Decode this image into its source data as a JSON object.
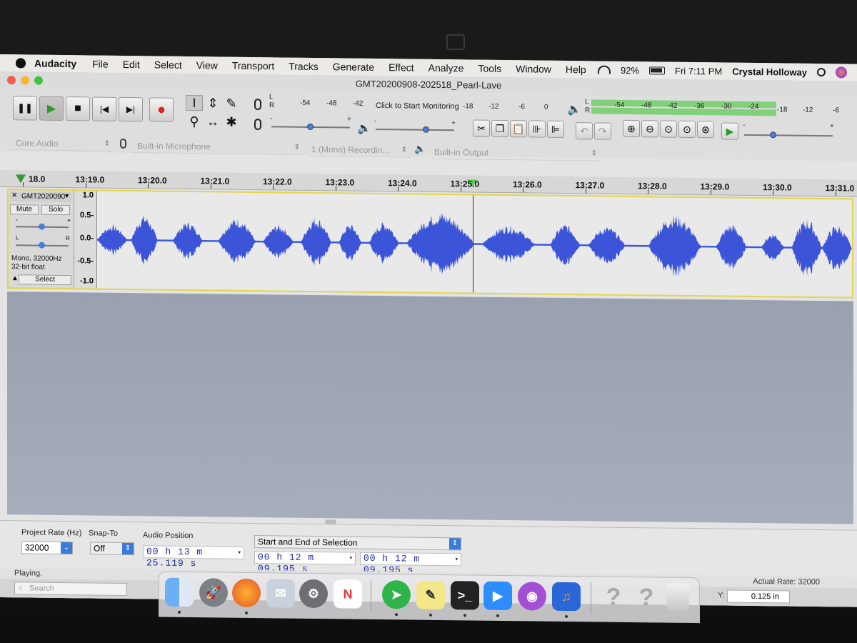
{
  "menubar": {
    "app_name": "Audacity",
    "items": [
      "File",
      "Edit",
      "Select",
      "View",
      "Transport",
      "Tracks",
      "Generate",
      "Effect",
      "Analyze",
      "Tools",
      "Window",
      "Help"
    ],
    "battery": "92%",
    "clock": "Fri 7:11 PM",
    "user": "Crystal Holloway"
  },
  "window": {
    "title": "GMT20200908-202518_Pearl-Lave"
  },
  "transport": {
    "pause": "❚❚",
    "play": "▶",
    "stop": "■",
    "skip_start": "|◀",
    "skip_end": "▶|",
    "record": "●"
  },
  "tools": {
    "select": "I",
    "envelope": "⇕",
    "draw": "✎",
    "zoom": "⚲",
    "timeshift": "↔",
    "multi": "✱"
  },
  "recording_meter": {
    "scale": [
      "-54",
      "-48",
      "-42",
      "-18",
      "-12",
      "-6",
      "0"
    ],
    "monitor_text": "Click to Start Monitoring",
    "channels": [
      "L",
      "R"
    ]
  },
  "playback_meter": {
    "scale": [
      "-54",
      "-48",
      "-42",
      "-36",
      "-30",
      "-24",
      "-18",
      "-12",
      "-6"
    ],
    "channels": [
      "L",
      "R"
    ],
    "level_fraction": 0.72
  },
  "mixer": {
    "minus": "-",
    "plus": "+"
  },
  "devices": {
    "host": "Core Audio",
    "recording_device": "Built-in Microphone",
    "channels": "1 (Mono) Recordin...",
    "playback_device": "Built-in Output"
  },
  "ruler": {
    "labels": [
      "18.0",
      "13:19.0",
      "13:20.0",
      "13:21.0",
      "13:22.0",
      "13:23.0",
      "13:24.0",
      "13:25.0",
      "13:26.0",
      "13:27.0",
      "13:28.0",
      "13:29.0",
      "13:30.0",
      "13:31.0"
    ]
  },
  "track": {
    "name": "GMT2020090",
    "mute": "Mute",
    "solo": "Solo",
    "gain_minus": "-",
    "gain_plus": "+",
    "pan_left": "L",
    "pan_right": "R",
    "info_line1": "Mono, 32000Hz",
    "info_line2": "32-bit float",
    "select": "Select",
    "scale": [
      "1.0",
      "0.5-",
      "0.0-",
      "-0.5-",
      "-1.0"
    ],
    "wave_color": "#3c55d8"
  },
  "selection_toolbar": {
    "project_rate_label": "Project Rate (Hz)",
    "project_rate_value": "32000",
    "snap_label": "Snap-To",
    "snap_value": "Off",
    "audio_position_label": "Audio Position",
    "audio_position": "00 h 13 m 25.119 s",
    "selection_mode": "Start and End of Selection",
    "selection_start": "00 h 12 m 09.195 s",
    "selection_end": "00 h 12 m 09.195 s"
  },
  "status": {
    "text": "Playing.",
    "actual_rate": "Actual Rate: 32000"
  },
  "background_window": {
    "search_placeholder": "Search",
    "y_label": "Y:",
    "y_value": "0.125 in"
  },
  "dock": {
    "icons": [
      "finder-icon",
      "launchpad-icon",
      "firefox-icon",
      "mail-icon",
      "system-preferences-icon",
      "news-icon",
      "telegram-icon",
      "notes-icon",
      "terminal-icon",
      "zoom-icon",
      "podcasts-icon",
      "audacity-icon",
      "help-icon",
      "help-icon",
      "trash-icon"
    ],
    "help_glyph": "?"
  }
}
